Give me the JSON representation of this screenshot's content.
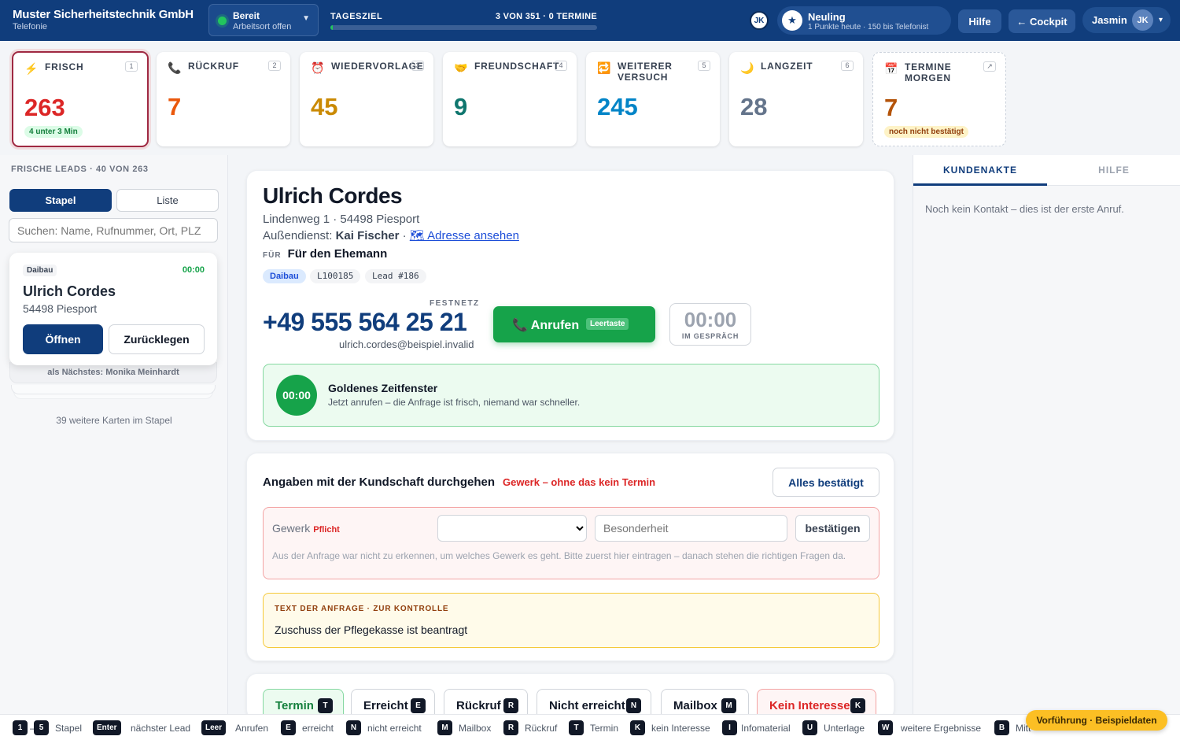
{
  "header": {
    "company": "Muster Sicherheitstechnik GmbH",
    "department": "Telefonie",
    "status_title": "Bereit",
    "status_sub": "Arbeitsort offen",
    "goal_label": "TAGESZIEL",
    "goal_value": "3 VON 351 · 0 TERMINE",
    "goal_progress": 0.0085,
    "avatar_small": "JK",
    "rank_title": "Neuling",
    "rank_sub": "1 Punkte heute · 150 bis Telefonist",
    "help_label": "Hilfe",
    "cockpit_label": "← Cockpit",
    "user_name": "Jasmin",
    "user_initials": "JK"
  },
  "queues": [
    {
      "icon": "⚡",
      "label": "FRISCH",
      "key": "1",
      "count": "263",
      "badge": "4 unter 3 Min",
      "color": "#dc2626"
    },
    {
      "icon": "📞",
      "label": "RÜCKRUF",
      "key": "2",
      "count": "7",
      "color": "#ea580c"
    },
    {
      "icon": "⏰",
      "label": "WIEDERVORLAGE",
      "key": "3",
      "count": "45",
      "color": "#ca8a04"
    },
    {
      "icon": "🤝",
      "label": "FREUNDSCHAFT",
      "key": "4",
      "count": "9",
      "color": "#0f766e"
    },
    {
      "icon": "🔁",
      "label": "WEITERER VERSUCH",
      "key": "5",
      "count": "245",
      "color": "#0284c7"
    },
    {
      "icon": "🌙",
      "label": "LANGZEIT",
      "key": "6",
      "count": "28",
      "color": "#64748b"
    },
    {
      "icon": "📅",
      "label": "TERMINE MORGEN",
      "key": "↗",
      "count": "7",
      "badge": "noch nicht bestätigt",
      "color": "#b45309"
    }
  ],
  "left": {
    "title": "FRISCHE LEADS · 40 VON 263",
    "tab_stack": "Stapel",
    "tab_list": "Liste",
    "search_placeholder": "Suchen: Name, Rufnummer, Ort, PLZ",
    "lead_tag": "Daibau",
    "lead_time": "00:00",
    "lead_name": "Ulrich Cordes",
    "lead_place": "54498 Piesport",
    "open_label": "Öffnen",
    "back_label": "Zurücklegen",
    "next_label": "als Nächstes: Monika Meinhardt",
    "more_label": "39 weitere Karten im Stapel"
  },
  "contact": {
    "name": "Ulrich Cordes",
    "address": "Lindenweg 1 · 54498 Piesport",
    "field_prefix": "Außendienst:",
    "field_rep": "Kai Fischer",
    "map_link": "🗺 Adresse ansehen",
    "for_label": "FÜR",
    "for_value": "Für den Ehemann",
    "chips": [
      "Daibau",
      "L100185",
      "Lead #186"
    ],
    "phone_label": "FESTNETZ",
    "phone": "+49 555 564 25 21",
    "email": "ulrich.cordes@beispiel.invalid",
    "call_label": "📞 Anrufen",
    "call_key": "Leertaste",
    "timer": "00:00",
    "timer_label": "IM GESPRÄCH",
    "golden_timer": "00:00",
    "golden_title": "Goldenes Zeitfenster",
    "golden_sub": "Jetzt anrufen – die Anfrage ist frisch, niemand war schneller."
  },
  "checks": {
    "heading": "Angaben mit der Kundschaft durchgehen",
    "warning": "Gewerk – ohne das kein Termin",
    "confirm_all": "Alles bestätigt",
    "gewerk_label": "Gewerk",
    "required": "Pflicht",
    "special_placeholder": "Besonderheit",
    "confirm": "bestätigen",
    "gewerk_hint": "Aus der Anfrage war nicht zu erkennen, um welches Gewerk es geht. Bitte zuerst hier eintragen – danach stehen die richtigen Fragen da.",
    "request_label": "TEXT DER ANFRAGE · ZUR KONTROLLE",
    "request_text": "Zuschuss der Pflegekasse ist beantragt"
  },
  "outcomes": [
    {
      "label": "Termin",
      "key": "T"
    },
    {
      "label": "Erreicht",
      "key": "E"
    },
    {
      "label": "Rückruf",
      "key": "R"
    },
    {
      "label": "Nicht erreicht",
      "key": "N"
    },
    {
      "label": "Mailbox",
      "key": "M"
    },
    {
      "label": "Kein Interesse",
      "key": "K"
    }
  ],
  "right": {
    "tab_file": "KUNDENAKTE",
    "tab_help": "HILFE",
    "message": "Noch kein Kontakt – dies ist der erste Anruf."
  },
  "footer": {
    "k1": "1",
    "k5": "5",
    "dash": "–",
    "l_stack": "Stapel",
    "k_enter": "Enter",
    "l_next": "nächster Lead",
    "k_space": "Leer",
    "l_call": "Anrufen",
    "k_e": "E",
    "l_e": "erreicht",
    "k_n": "N",
    "l_n": "nicht erreicht",
    "k_m": "M",
    "l_m": "Mailbox",
    "k_r": "R",
    "l_r": "Rückruf",
    "k_t": "T",
    "l_t": "Termin",
    "k_k": "K",
    "l_k": "kein Interesse",
    "k_i": "I",
    "l_i": "Infomaterial",
    "k_u": "U",
    "l_u": "Unterlage",
    "k_w": "W",
    "l_w": "weitere Ergebnisse",
    "k_b": "B",
    "l_b": "Mitt",
    "demo": "Vorführung · Beispieldaten"
  }
}
